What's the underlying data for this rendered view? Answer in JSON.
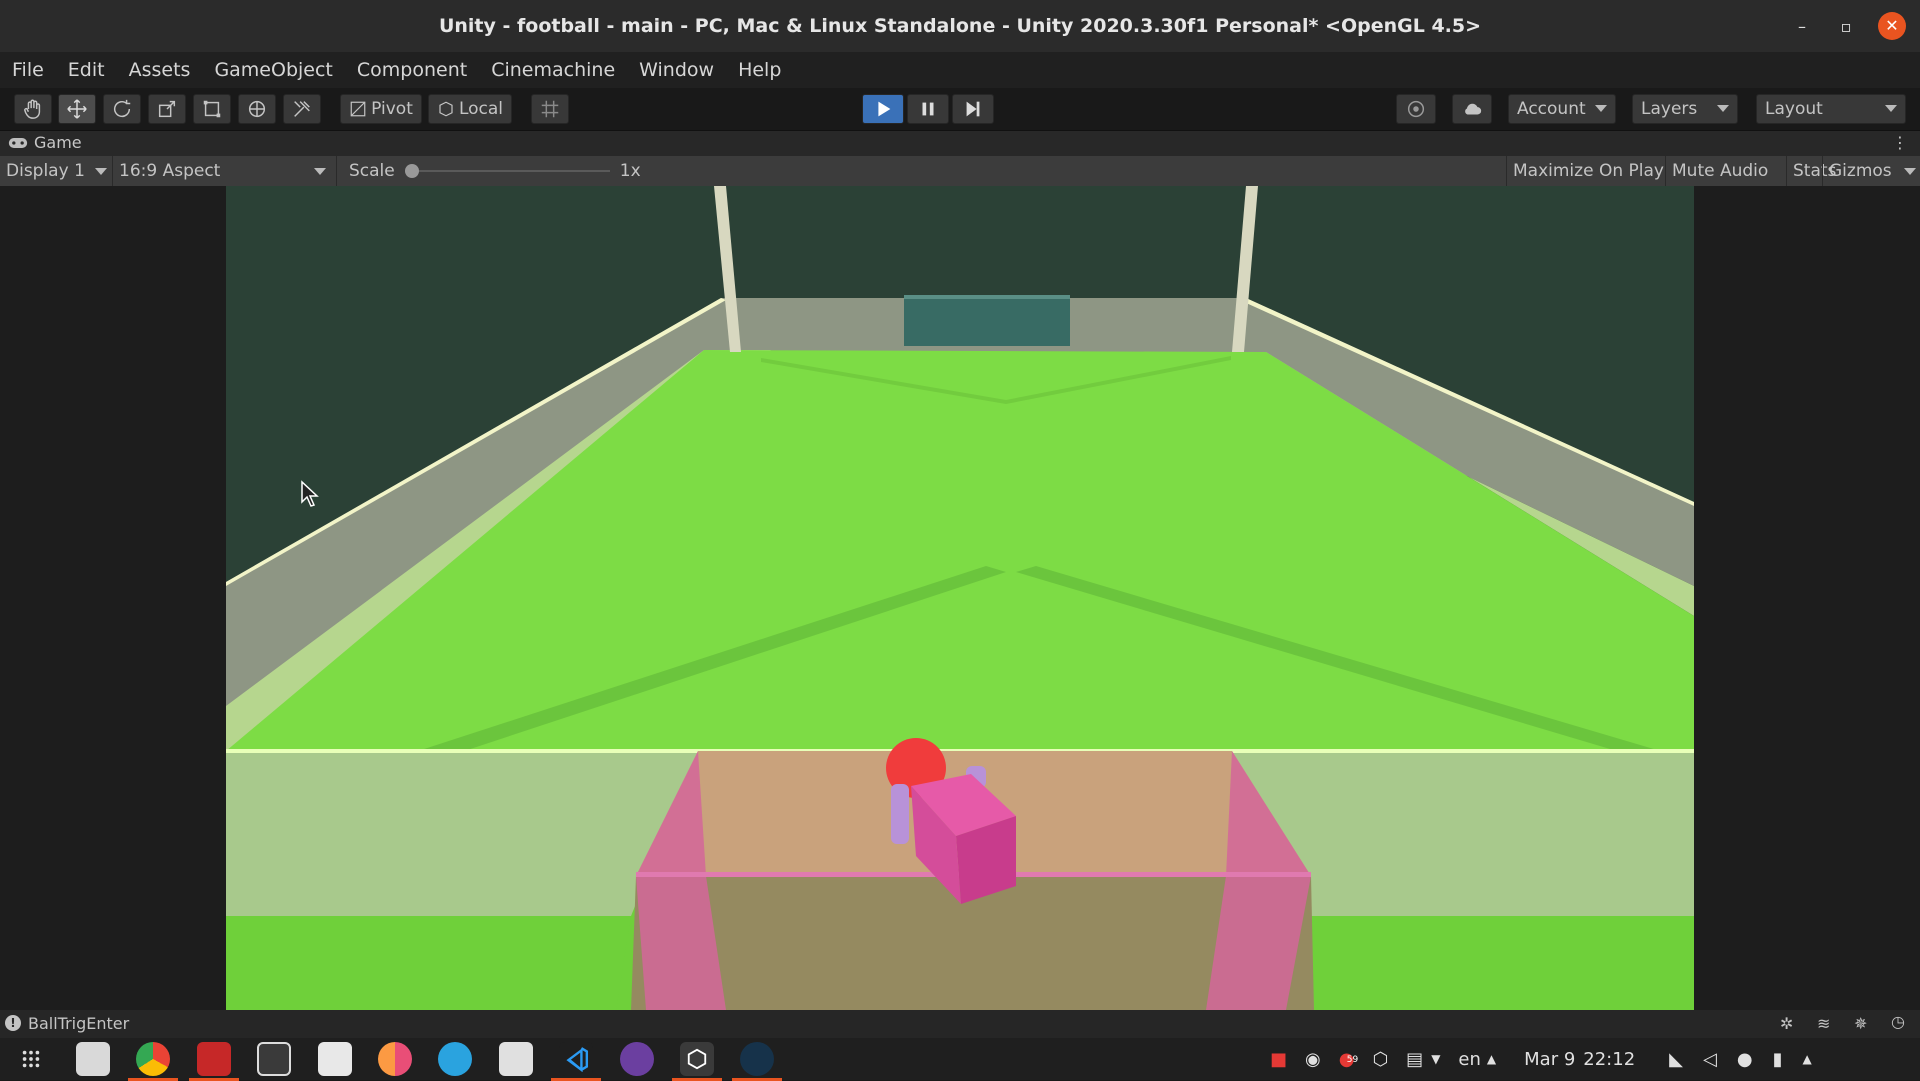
{
  "window": {
    "title": "Unity - football - main - PC, Mac & Linux Standalone - Unity 2020.3.30f1 Personal* <OpenGL 4.5>",
    "minimize": "–",
    "maximize": "▫",
    "close": "✕"
  },
  "menu": [
    "File",
    "Edit",
    "Assets",
    "GameObject",
    "Component",
    "Cinemachine",
    "Window",
    "Help"
  ],
  "toolbar": {
    "pivot": "Pivot",
    "local": "Local",
    "account": "Account",
    "layers": "Layers",
    "layout": "Layout"
  },
  "tab": {
    "label": "Game"
  },
  "gamebar": {
    "display": "Display 1",
    "aspect": "16:9 Aspect",
    "scale_label": "Scale",
    "scale_value": "1x",
    "maximize": "Maximize On Play",
    "mute": "Mute Audio",
    "stats": "Stats",
    "gizmos": "Gizmos"
  },
  "status": {
    "message": "BallTrigEnter"
  },
  "taskbar": {
    "lang": "en",
    "date": "Mar 9",
    "time": "22:12",
    "badge": "59"
  },
  "colors": {
    "field": "#7ddc45",
    "play_button": "#3a71b8",
    "ubuntu_accent": "#e95420"
  }
}
